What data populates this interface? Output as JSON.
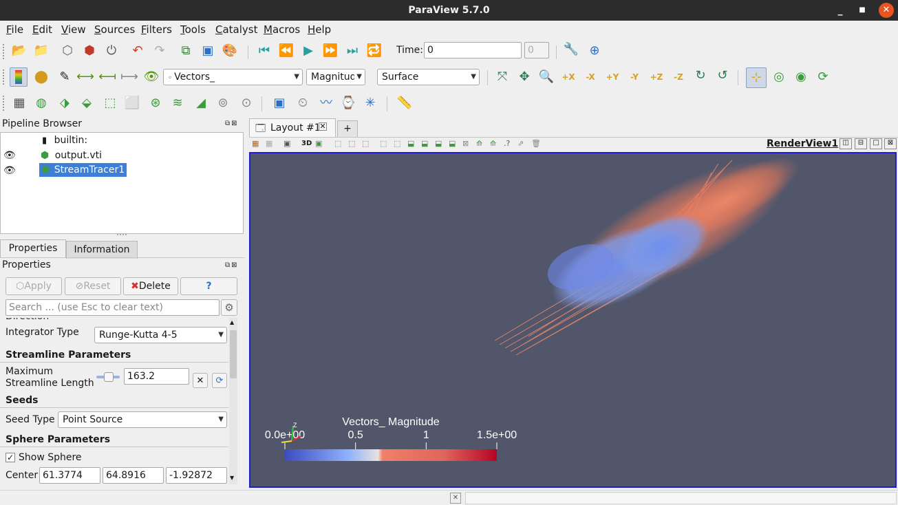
{
  "window": {
    "title": "ParaView 5.7.0",
    "minimize": "_",
    "maximize": "□",
    "close": "✕"
  },
  "menubar": [
    "File",
    "Edit",
    "View",
    "Sources",
    "Filters",
    "Tools",
    "Catalyst",
    "Macros",
    "Help"
  ],
  "time_toolbar": {
    "label": "Time:",
    "value": "0",
    "index": "0"
  },
  "display_toolbar": {
    "array": "Vectors_",
    "component": "Magnitude",
    "representation": "Surface"
  },
  "pipeline_browser": {
    "title": "Pipeline Browser",
    "items": [
      {
        "label": "builtin:",
        "visible": false
      },
      {
        "label": "output.vti",
        "visible": true
      },
      {
        "label": "StreamTracer1",
        "visible": true,
        "selected": true
      }
    ]
  },
  "tabs": {
    "properties": "Properties",
    "information": "Information"
  },
  "properties": {
    "title": "Properties",
    "buttons": {
      "apply": "Apply",
      "reset": "Reset",
      "delete": "Delete",
      "help": "?"
    },
    "search_placeholder": "Search ... (use Esc to clear text)",
    "integrator_type_label": "Integrator Type",
    "integrator_type": "Runge-Kutta 4-5",
    "streamline_section": "Streamline Parameters",
    "max_length_label_1": "Maximum",
    "max_length_label_2": "Streamline Length",
    "max_length": "163.2",
    "seeds_section": "Seeds",
    "seed_type_label": "Seed Type",
    "seed_type": "Point Source",
    "sphere_section": "Sphere Parameters",
    "show_sphere_label": "Show Sphere",
    "show_sphere": true,
    "center_label": "Center",
    "center": [
      "61.3774",
      "64.8916",
      "-1.92872"
    ]
  },
  "layout": {
    "tab_label": "Layout #1",
    "add_tab": "+",
    "view_name": "RenderView1",
    "mode_3d": "3D"
  },
  "colorbar": {
    "title": "Vectors_ Magnitude",
    "ticks": [
      "0.0e+00",
      "0.5",
      "1",
      "1.5e+00"
    ],
    "range": [
      0,
      1.5
    ],
    "colors": {
      "low": "#3b4cc0",
      "mid": "#e8e2de",
      "high": "#b40426"
    }
  },
  "colors": {
    "background": "#51566b",
    "accent": "#e95420",
    "selection": "#3d7fd6"
  }
}
